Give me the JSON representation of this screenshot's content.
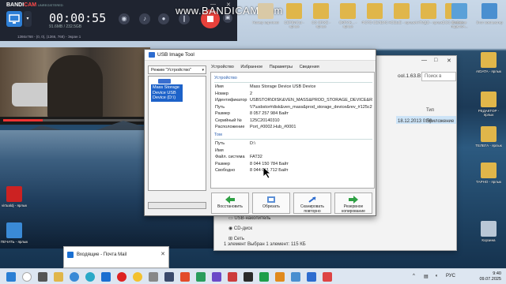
{
  "bandicam": {
    "logo_main": "BANDI",
    "logo_accent": "CAM",
    "logo_sub": "UNREGISTERED",
    "timer": "00:00:55",
    "size": "91.6MB / 232.5GB",
    "resolution": "1366x768 - (0, 0), (1366, 768) - Экран 1",
    "minimize": "—",
    "close": "✕"
  },
  "watermark": "www.BANDICAM.com",
  "desktop_icons": [
    "Номер картинки",
    "СЕРВИСЫ - ярлык",
    "СО SFIXE - ярлык",
    "ОКРУЖ... - ярлык",
    "ФОТО СЕЛВИС",
    "НОВЫЕ - ярлык",
    "АНТИДО - ярлык",
    "DOC DASHA",
    "Сетевые подключ...",
    "Этот компьютер",
    "AIDATA - ярлык",
    "РЕДАКТОР - ярлык",
    "ТЕЛЕГА - ярлык",
    "ТАРНО - ярлык",
    "virtualdj - ярлык",
    "ПЕЧАТЬ - ярлык",
    "Корзина"
  ],
  "explorer": {
    "path_fragment": "ool.1.63.B",
    "search_placeholder": "Поиск в",
    "col_type": "Тип",
    "row_date": "18.12.2013 0:56",
    "row_type": "Приложение",
    "nav": [
      "USB-накопитель",
      "CD-диск",
      "Сеть"
    ],
    "status": "1 элемент    Выбран 1 элемент: 115 КБ"
  },
  "usbtool": {
    "title": "USB Image Tool",
    "mode": "Режим \"Устройство\"",
    "device_label": "Mass Storage Device USB Device (D:\\)",
    "tabs": [
      "Устройство",
      "Избранное",
      "Параметры",
      "Сведения"
    ],
    "device_group": "Устройство",
    "device_rows": [
      {
        "k": "Имя",
        "v": "Mass Storage Device USB Device"
      },
      {
        "k": "Номер",
        "v": "2"
      },
      {
        "k": "Идентификатор",
        "v": "USBSTOR\\DISK&VEN_MASS&PROD_STORAGE_DEVICE&REV__"
      },
      {
        "k": "Путь",
        "v": "\\\\?\\usbstor#disk&ven_mass&prod_storage_device&rev_#125c2014"
      },
      {
        "k": "Размер",
        "v": "8 057 257 984 Байт"
      },
      {
        "k": "Серийный №",
        "v": "125C20140310"
      },
      {
        "k": "Расположение",
        "v": "Port_#0002.Hub_#0001"
      }
    ],
    "volume_group": "Том",
    "volume_rows": [
      {
        "k": "Путь",
        "v": "D:\\"
      },
      {
        "k": "Имя",
        "v": ""
      },
      {
        "k": "Файл. система",
        "v": "FAT32"
      },
      {
        "k": "Размер",
        "v": "8 044 150 784 Байт"
      },
      {
        "k": "Свободно",
        "v": "8 044 011 712 Байт"
      }
    ],
    "buttons": [
      "Восстановить",
      "Обрезать",
      "Сканировать повторно",
      "Резервное копирование"
    ]
  },
  "mail": {
    "title": "Входящие - Почта Mail",
    "close": "✕"
  },
  "taskbar": {
    "time": "9:40",
    "date": "09.07.2025",
    "lang": "РУС"
  },
  "colors": {
    "accent": "#1d62c9",
    "record": "#e8413b",
    "group_title": "#2a5fb0"
  }
}
